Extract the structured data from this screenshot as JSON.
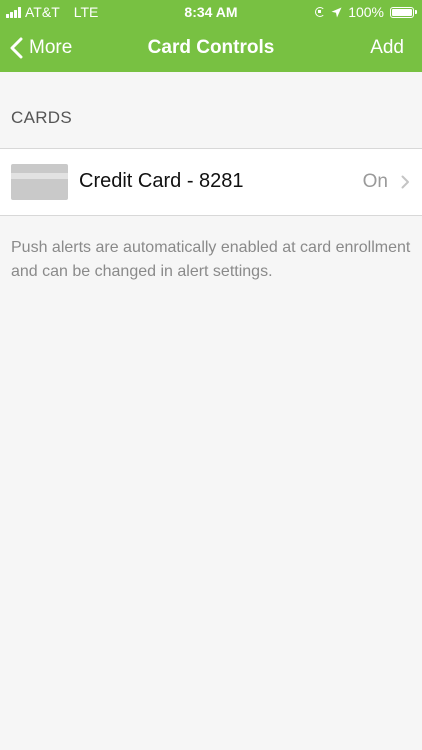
{
  "status_bar": {
    "carrier": "AT&T",
    "network": "LTE",
    "time": "8:34 AM",
    "battery": "100%",
    "icons": [
      "signal-icon",
      "rotation-lock-icon",
      "location-icon",
      "battery-icon"
    ]
  },
  "nav": {
    "back_label": "More",
    "title": "Card Controls",
    "add_label": "Add"
  },
  "section": {
    "header": "CARDS"
  },
  "cards": [
    {
      "name": "Credit Card - 8281",
      "status": "On"
    }
  ],
  "info": {
    "text": "Push alerts are automatically enabled at card enrollment and can be changed in alert settings."
  },
  "colors": {
    "accent": "#78c142",
    "background": "#f6f6f6",
    "row_background": "#ffffff",
    "muted_text": "#8a8a8a"
  }
}
